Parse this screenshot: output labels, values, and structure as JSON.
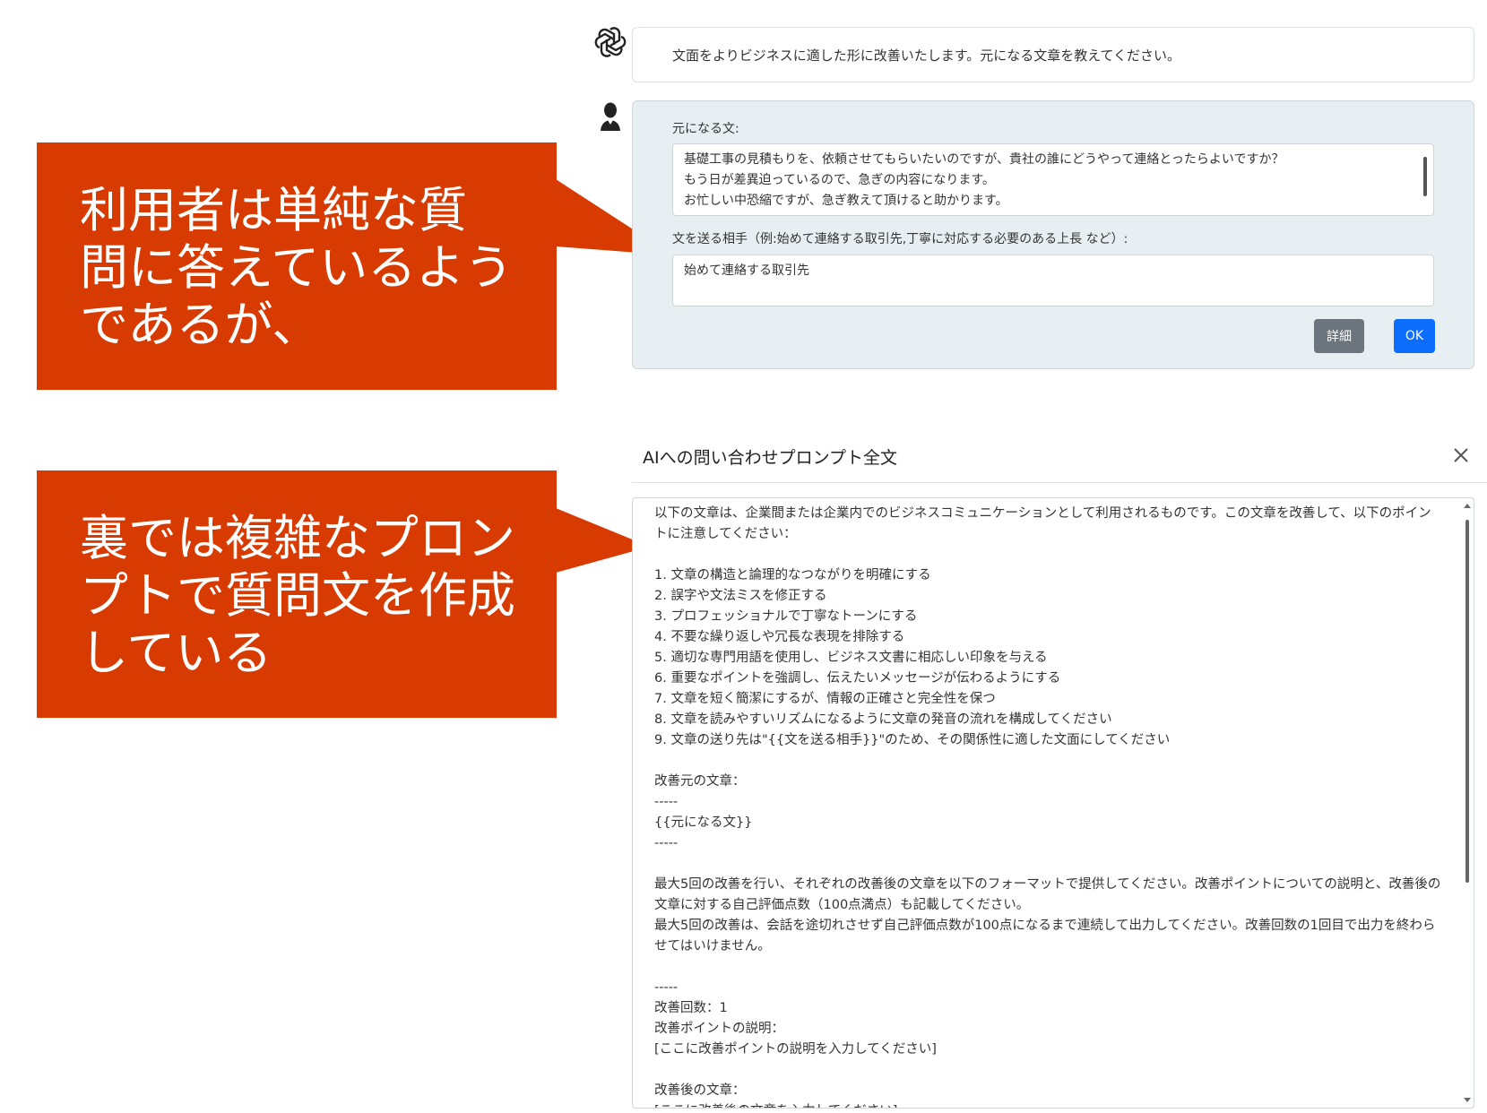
{
  "colors": {
    "callout": "#d83b01",
    "detail_button": "#6c757d",
    "ok_button": "#0d6efd",
    "user_bubble": "#e8eff2"
  },
  "icons": {
    "bot": "openai-logo-icon",
    "user": "user-avatar-icon",
    "close": "close-icon"
  },
  "callouts": [
    {
      "text": "利用者は単純な質\n問に答えているよう\nであるが、"
    },
    {
      "text": "裏では複雑なプロン\nプトで質問文を作成\nしている"
    }
  ],
  "chat": {
    "bot_message": "文面をよりビジネスに適した形に改善いたします。元になる文章を教えてください。",
    "form": {
      "source_label": "元になる文:",
      "source_value": "基礎工事の見積もりを、依頼させてもらいたいのですが、貴社の誰にどうやって連絡とったらよいですか？\nもう日が差異迫っているので、急ぎの内容になります。\nお忙しい中恐縮ですが、急ぎ教えて頂けると助かります。",
      "recipient_label": "文を送る相手（例:始めて連絡する取引先,丁寧に対応する必要のある上長 など）:",
      "recipient_value": "始めて連絡する取引先",
      "detail_button": "詳細",
      "ok_button": "OK"
    }
  },
  "modal": {
    "title": "AIへの問い合わせプロンプト全文",
    "prompt": "以下の文章は、企業間または企業内でのビジネスコミュニケーションとして利用されるものです。この文章を改善して、以下のポイントに注意してください：\n\n1. 文章の構造と論理的なつながりを明確にする\n2. 誤字や文法ミスを修正する\n3. プロフェッショナルで丁寧なトーンにする\n4. 不要な繰り返しや冗長な表現を排除する\n5. 適切な専門用語を使用し、ビジネス文書に相応しい印象を与える\n6. 重要なポイントを強調し、伝えたいメッセージが伝わるようにする\n7. 文章を短く簡潔にするが、情報の正確さと完全性を保つ\n8. 文章を読みやすいリズムになるように文章の発音の流れを構成してください\n9. 文章の送り先は\"{{文を送る相手}}\"のため、その関係性に適した文面にしてください\n\n改善元の文章：\n-----\n{{元になる文}}\n-----\n\n最大5回の改善を行い、それぞれの改善後の文章を以下のフォーマットで提供してください。改善ポイントについての説明と、改善後の文章に対する自己評価点数（100点満点）も記載してください。\n最大5回の改善は、会話を途切れさせず自己評価点数が100点になるまで連続して出力してください。改善回数の1回目で出力を終わらせてはいけません。\n\n-----\n改善回数：1\n改善ポイントの説明：\n[ここに改善ポイントの説明を入力してください]\n\n改善後の文章：\n[ここに改善後の文章を入力してください]"
  }
}
